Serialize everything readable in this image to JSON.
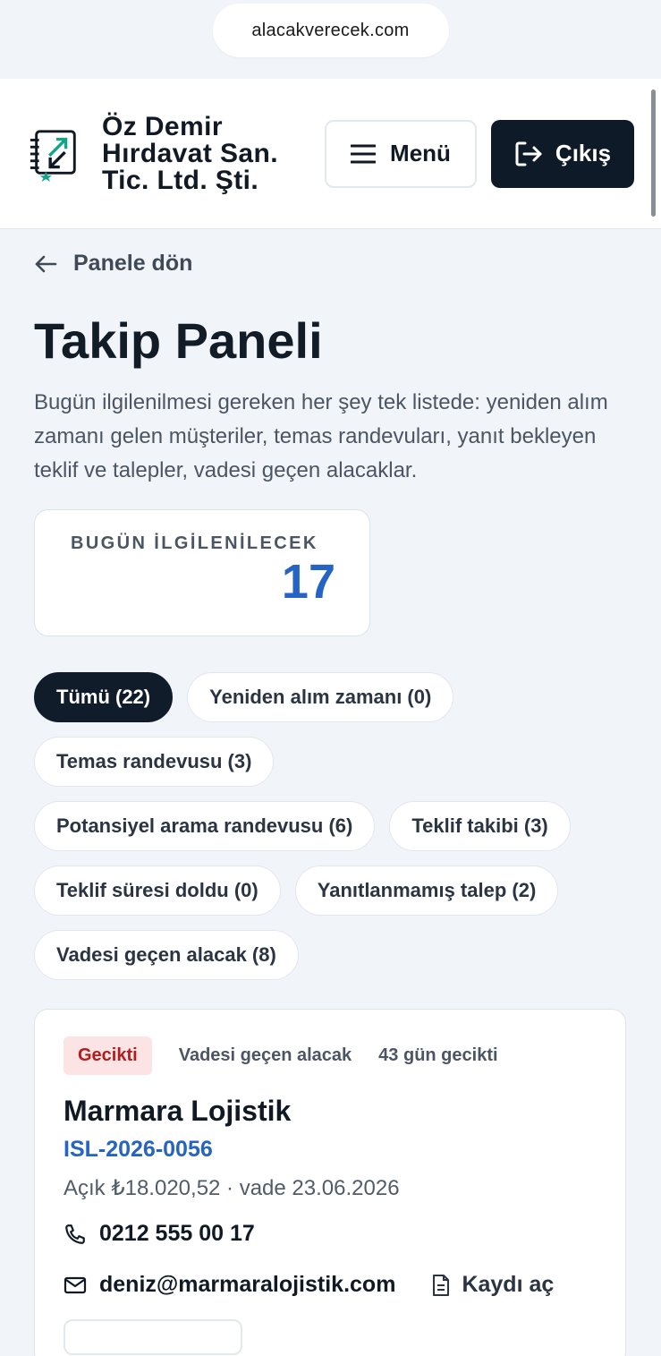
{
  "browser": {
    "url": "alacakverecek.com"
  },
  "header": {
    "company": "Öz Demir Hırdavat San. Tic. Ltd. Şti.",
    "menu_label": "Menü",
    "exit_label": "Çıkış"
  },
  "back_label": "Panele dön",
  "page_title": "Takip Paneli",
  "description": "Bugün ilgilenilmesi gereken her şey tek listede: yeniden alım zamanı gelen müşteriler, temas randevuları, yanıt bekleyen teklif ve talepler, vadesi geçen alacaklar.",
  "stat": {
    "label": "BUGÜN İLGİLENİLECEK",
    "value": "17"
  },
  "filters": [
    {
      "label": "Tümü (22)",
      "active": true
    },
    {
      "label": "Yeniden alım zamanı (0)",
      "active": false
    },
    {
      "label": "Temas randevusu (3)",
      "active": false
    },
    {
      "label": "Potansiyel arama randevusu (6)",
      "active": false
    },
    {
      "label": "Teklif takibi (3)",
      "active": false
    },
    {
      "label": "Teklif süresi doldu (0)",
      "active": false
    },
    {
      "label": "Yanıtlanmamış talep (2)",
      "active": false
    },
    {
      "label": "Vadesi geçen alacak (8)",
      "active": false
    }
  ],
  "card": {
    "badge": "Gecikti",
    "category": "Vadesi geçen alacak",
    "delay": "43 gün gecikti",
    "title": "Marmara Lojistik",
    "code": "ISL-2026-0056",
    "amount_line": "Açık ₺18.020,52 · vade 23.06.2026",
    "phone": "0212 555 00 17",
    "email": "deniz@marmaralojistik.com",
    "open_label": "Kaydı aç"
  },
  "colors": {
    "accent_blue": "#2563c4",
    "dark": "#0f1a28",
    "danger_bg": "#fde4e4",
    "danger_text": "#b11d1d",
    "logo_teal": "#13a58a"
  }
}
